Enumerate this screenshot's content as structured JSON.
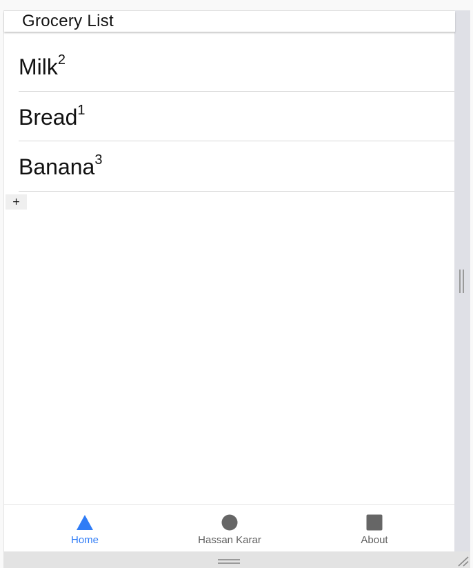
{
  "header": {
    "title": "Grocery List"
  },
  "items": [
    {
      "name": "Milk",
      "qty": "2"
    },
    {
      "name": "Bread",
      "qty": "1"
    },
    {
      "name": "Banana",
      "qty": "3"
    }
  ],
  "add_button": {
    "label": "+"
  },
  "tabs": [
    {
      "label": "Home",
      "icon": "triangle-icon",
      "active": true
    },
    {
      "label": "Hassan Karar",
      "icon": "circle-icon",
      "active": false
    },
    {
      "label": "About",
      "icon": "square-icon",
      "active": false
    }
  ],
  "colors": {
    "active": "#2f7cf6",
    "inactive_icon": "#666666",
    "inactive_text": "#5f5f5f"
  }
}
